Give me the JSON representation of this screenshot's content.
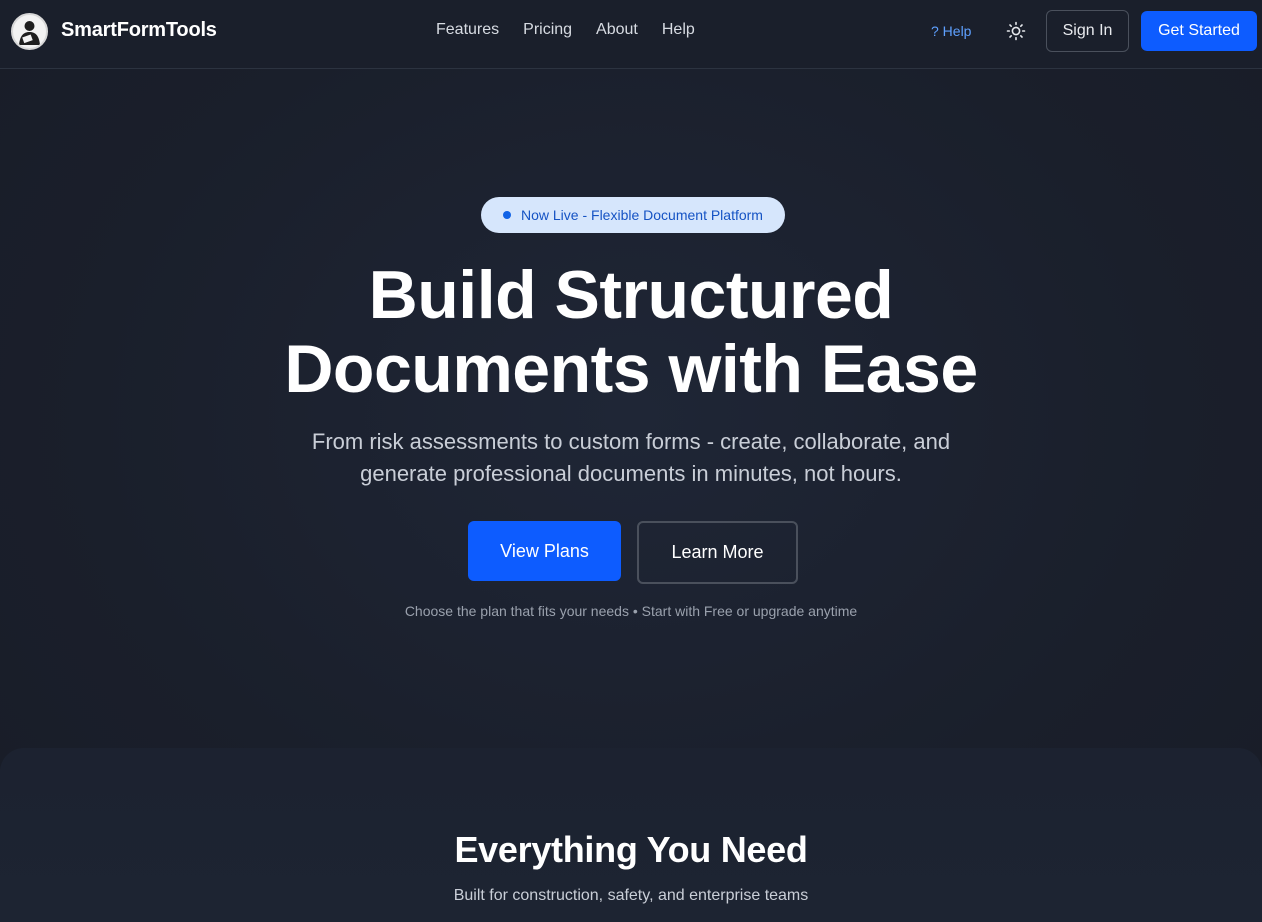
{
  "header": {
    "brand": "SmartFormTools",
    "nav": [
      "Features",
      "Pricing",
      "About",
      "Help"
    ],
    "help_link": "? Help",
    "signin_label": "Sign In",
    "getstarted_label": "Get Started"
  },
  "hero": {
    "badge": "Now Live - Flexible Document Platform",
    "title_line1": "Build Structured",
    "title_line2": "Documents with Ease",
    "subtitle": "From risk assessments to custom forms - create, collaborate, and generate professional documents in minutes, not hours.",
    "primary_cta": "View Plans",
    "secondary_cta": "Learn More",
    "hint": "Choose the plan that fits your needs • Start with Free or upgrade anytime"
  },
  "features": {
    "title": "Everything You Need",
    "subtitle": "Built for construction, safety, and enterprise teams"
  },
  "colors": {
    "accent": "#0d5cff",
    "background": "#1a1f2b",
    "badge_bg": "#d6e6fc",
    "help_link": "#5ea0ff"
  },
  "icons": {
    "logo": "worker-avatar-icon",
    "theme": "sun-icon"
  }
}
